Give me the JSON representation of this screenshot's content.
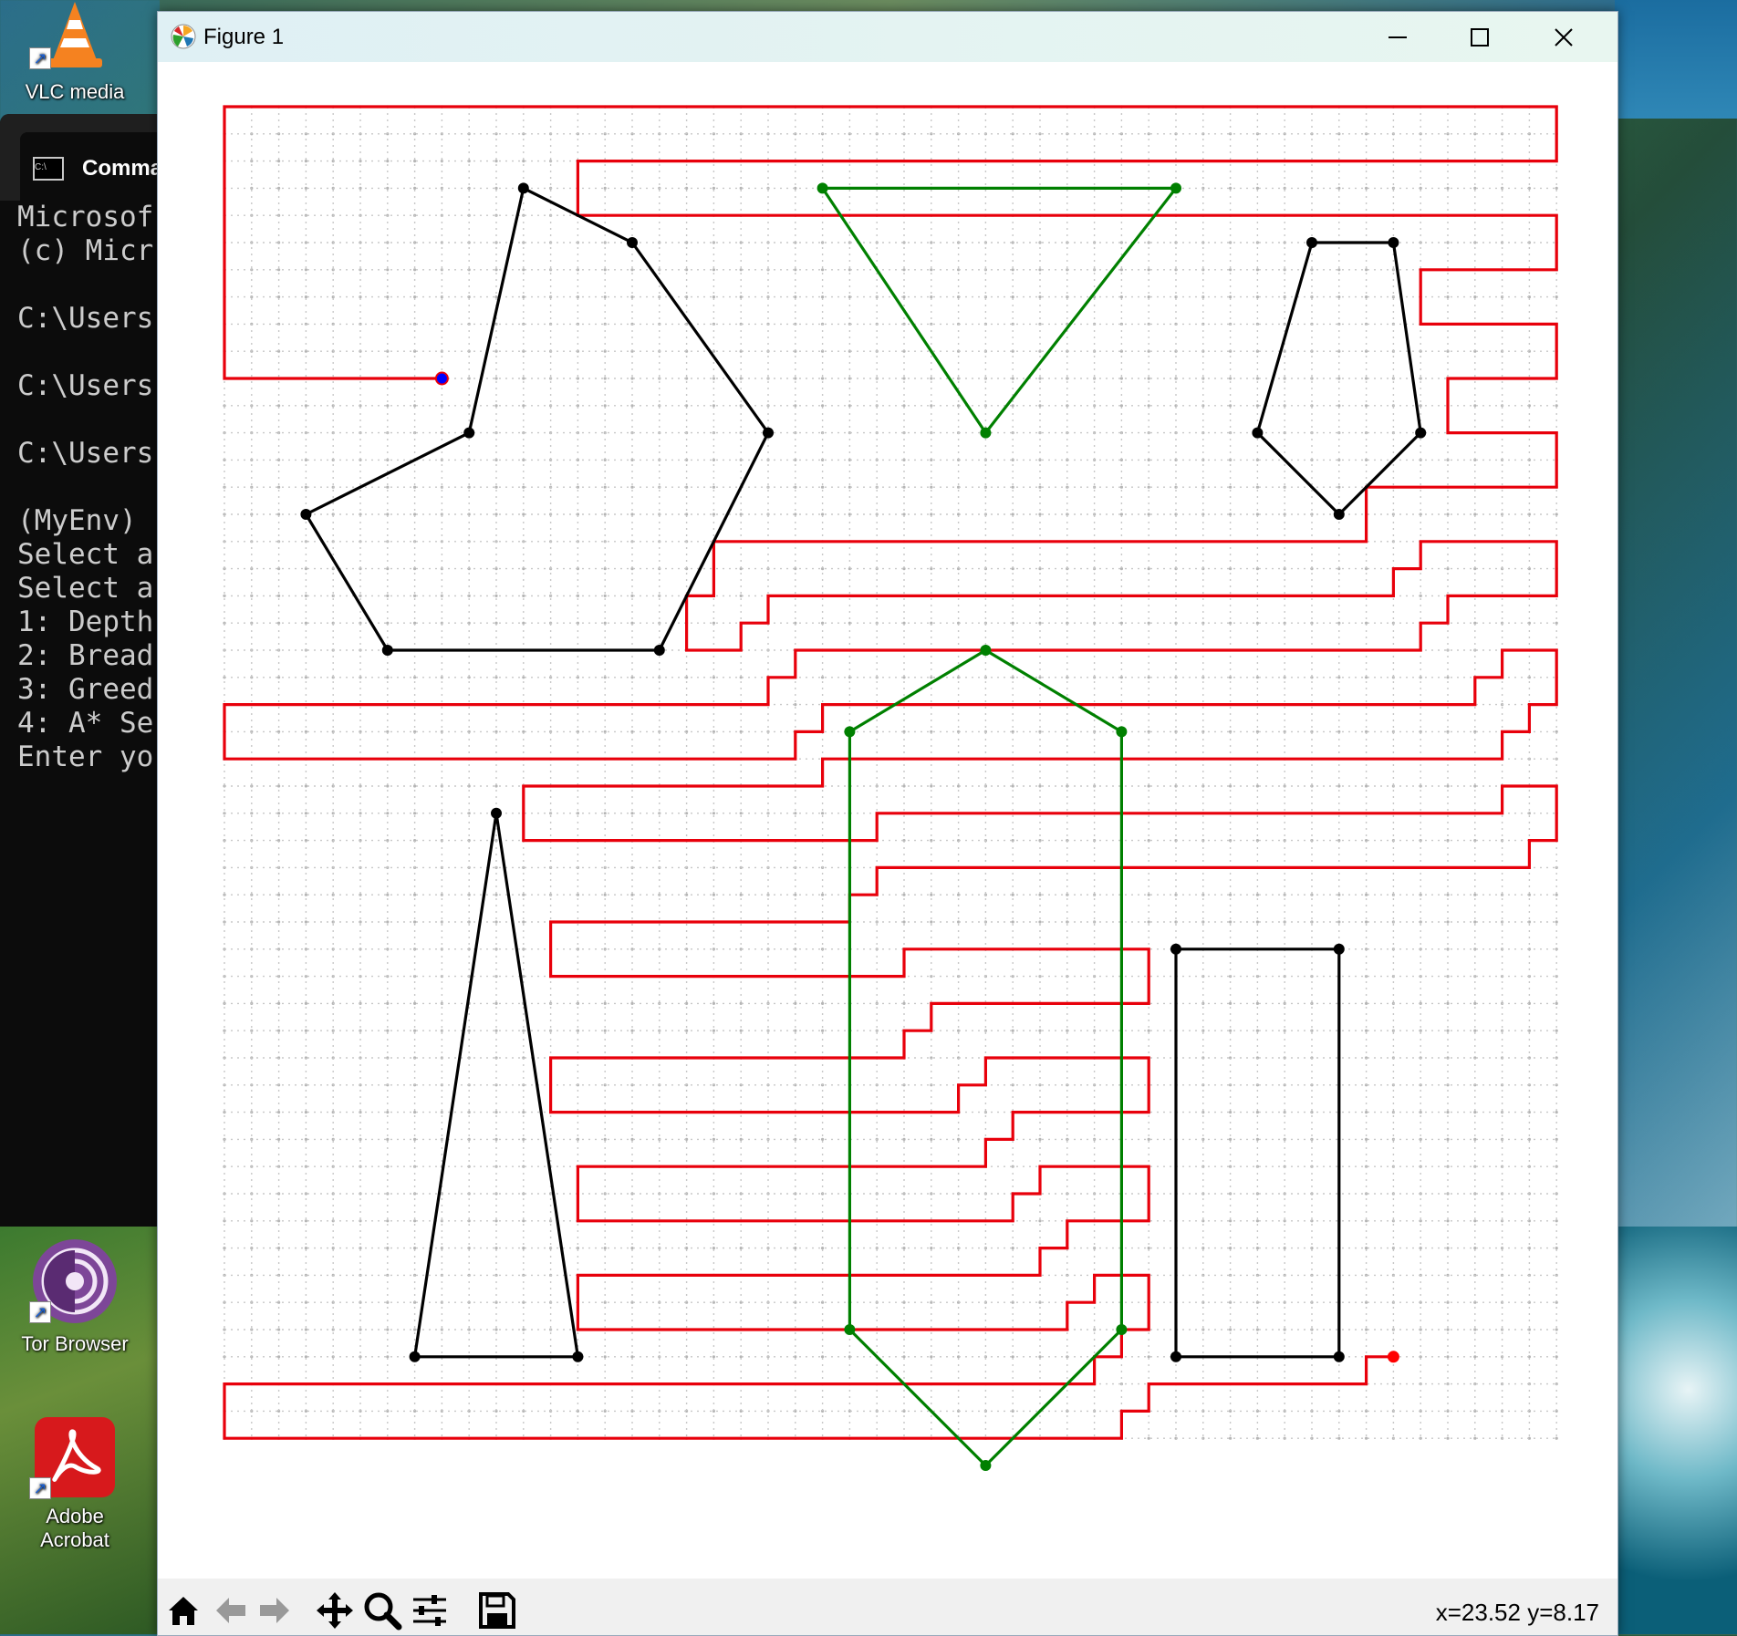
{
  "desktop": {
    "icons": [
      {
        "label": "VLC media",
        "icon": "vlc-cone-icon"
      },
      {
        "label": "Tor Browser",
        "icon": "tor-onion-icon"
      },
      {
        "label": "Adobe Acrobat",
        "icon": "acrobat-icon"
      }
    ]
  },
  "cmd": {
    "tab_title": "Comma",
    "lines": [
      "Microsof",
      "(c) Micr",
      "",
      "C:\\Users",
      "",
      "C:\\Users",
      "",
      "C:\\Users",
      "",
      "(MyEnv)",
      "Select a",
      "Select a",
      "1: Depth",
      "2: Bread",
      "3: Greed",
      "4: A* Se",
      "Enter yo"
    ]
  },
  "figure": {
    "title": "Figure 1",
    "controls": {
      "minimize": "minimize-icon",
      "maximize": "maximize-icon",
      "close": "close-icon"
    },
    "toolbar": {
      "buttons": [
        "home-icon",
        "back-arrow-icon",
        "forward-arrow-icon",
        "pan-icon",
        "zoom-icon",
        "configure-subplots-icon",
        "save-icon"
      ],
      "coords": "x=23.52 y=8.17"
    }
  },
  "chart_data": {
    "type": "line",
    "xlim": [
      0,
      49
    ],
    "ylim": [
      0,
      49
    ],
    "grid": "dotted points at every integer",
    "colors": {
      "path": "#e8000b",
      "black_polygon": "#000000",
      "green_polygon": "#008000",
      "start": "#0000ff",
      "goal": "#ff0000"
    },
    "start": [
      8,
      10
    ],
    "goal": [
      43,
      46
    ],
    "polygons_black": [
      [
        [
          7,
          46
        ],
        [
          13,
          46
        ],
        [
          10,
          26
        ]
      ],
      [
        [
          35,
          46
        ],
        [
          41,
          46
        ],
        [
          41,
          31
        ],
        [
          35,
          31
        ]
      ],
      [
        [
          6,
          20
        ],
        [
          16,
          20
        ],
        [
          20,
          12
        ],
        [
          15,
          5
        ],
        [
          11,
          3
        ],
        [
          9,
          12
        ],
        [
          3,
          15
        ]
      ],
      [
        [
          41,
          15
        ],
        [
          44,
          12
        ],
        [
          43,
          5
        ],
        [
          40,
          5
        ],
        [
          38,
          12
        ]
      ]
    ],
    "polygons_green": [
      [
        [
          28,
          50
        ],
        [
          33,
          45
        ],
        [
          33,
          23
        ],
        [
          28,
          20
        ],
        [
          23,
          23
        ],
        [
          23,
          45
        ]
      ],
      [
        [
          28,
          12
        ],
        [
          22,
          3
        ],
        [
          35,
          3
        ]
      ]
    ],
    "path": [
      [
        8,
        10
      ],
      [
        0,
        10
      ],
      [
        0,
        0
      ],
      [
        49,
        0
      ],
      [
        49,
        2
      ],
      [
        13,
        2
      ],
      [
        13,
        4
      ],
      [
        49,
        4
      ],
      [
        49,
        6
      ],
      [
        44,
        6
      ],
      [
        44,
        8
      ],
      [
        49,
        8
      ],
      [
        49,
        10
      ],
      [
        45,
        10
      ],
      [
        45,
        12
      ],
      [
        49,
        12
      ],
      [
        49,
        14
      ],
      [
        42,
        14
      ],
      [
        42,
        16
      ],
      [
        18,
        16
      ],
      [
        18,
        18
      ],
      [
        17,
        18
      ],
      [
        17,
        20
      ],
      [
        19,
        20
      ],
      [
        19,
        19
      ],
      [
        20,
        19
      ],
      [
        20,
        18
      ],
      [
        43,
        18
      ],
      [
        43,
        17
      ],
      [
        44,
        17
      ],
      [
        44,
        16
      ],
      [
        49,
        16
      ],
      [
        49,
        18
      ],
      [
        45,
        18
      ],
      [
        45,
        19
      ],
      [
        44,
        19
      ],
      [
        44,
        20
      ],
      [
        21,
        20
      ],
      [
        21,
        21
      ],
      [
        20,
        21
      ],
      [
        20,
        22
      ],
      [
        0,
        22
      ],
      [
        0,
        24
      ],
      [
        21,
        24
      ],
      [
        21,
        23
      ],
      [
        22,
        23
      ],
      [
        22,
        22
      ],
      [
        46,
        22
      ],
      [
        46,
        21
      ],
      [
        47,
        21
      ],
      [
        47,
        20
      ],
      [
        49,
        20
      ],
      [
        49,
        22
      ],
      [
        48,
        22
      ],
      [
        48,
        23
      ],
      [
        47,
        23
      ],
      [
        47,
        24
      ],
      [
        22,
        24
      ],
      [
        22,
        25
      ],
      [
        11,
        25
      ],
      [
        11,
        27
      ],
      [
        24,
        27
      ],
      [
        24,
        26
      ],
      [
        47,
        26
      ],
      [
        47,
        25
      ],
      [
        49,
        25
      ],
      [
        49,
        27
      ],
      [
        48,
        27
      ],
      [
        48,
        28
      ],
      [
        24,
        28
      ],
      [
        24,
        29
      ],
      [
        23,
        29
      ],
      [
        23,
        30
      ],
      [
        12,
        30
      ],
      [
        12,
        32
      ],
      [
        25,
        32
      ],
      [
        25,
        31
      ],
      [
        34,
        31
      ],
      [
        34,
        33
      ],
      [
        26,
        33
      ],
      [
        26,
        34
      ],
      [
        25,
        34
      ],
      [
        25,
        35
      ],
      [
        12,
        35
      ],
      [
        12,
        37
      ],
      [
        27,
        37
      ],
      [
        27,
        36
      ],
      [
        28,
        36
      ],
      [
        28,
        35
      ],
      [
        34,
        35
      ],
      [
        34,
        37
      ],
      [
        29,
        37
      ],
      [
        29,
        38
      ],
      [
        28,
        38
      ],
      [
        28,
        39
      ],
      [
        13,
        39
      ],
      [
        13,
        41
      ],
      [
        29,
        41
      ],
      [
        29,
        40
      ],
      [
        30,
        40
      ],
      [
        30,
        39
      ],
      [
        34,
        39
      ],
      [
        34,
        41
      ],
      [
        31,
        41
      ],
      [
        31,
        42
      ],
      [
        30,
        42
      ],
      [
        30,
        43
      ],
      [
        13,
        43
      ],
      [
        13,
        45
      ],
      [
        31,
        45
      ],
      [
        31,
        44
      ],
      [
        32,
        44
      ],
      [
        32,
        43
      ],
      [
        34,
        43
      ],
      [
        34,
        45
      ],
      [
        33,
        45
      ],
      [
        33,
        46
      ],
      [
        32,
        46
      ],
      [
        32,
        47
      ],
      [
        0,
        47
      ],
      [
        0,
        49
      ],
      [
        33,
        49
      ],
      [
        33,
        48
      ],
      [
        34,
        48
      ],
      [
        34,
        47
      ],
      [
        42,
        47
      ],
      [
        42,
        46
      ],
      [
        43,
        46
      ]
    ]
  }
}
